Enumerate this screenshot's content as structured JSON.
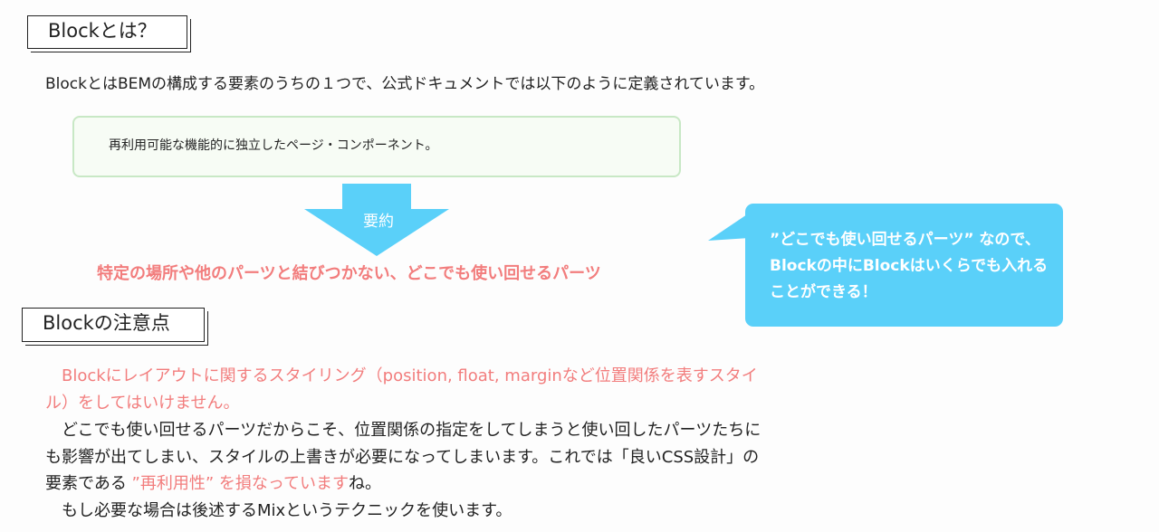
{
  "section1": {
    "heading": "Blockとは？",
    "intro": "BlockとはBEMの構成する要素のうちの１つで、公式ドキュメントでは以下のように定義されています。",
    "quote": "再利用可能な機能的に独立したページ・コンポーネント。",
    "arrow_label": "要約",
    "summary": "特定の場所や他のパーツと結びつかない、どこでも使い回せるパーツ",
    "bubble": "”どこでも使い回せるパーツ” なので、Blockの中にBlockはいくらでも入れることができる！"
  },
  "section2": {
    "heading": "Blockの注意点",
    "line1": "　Blockにレイアウトに関するスタイリング（position, float, marginなど位置関係を表すスタイ",
    "line2": "ル）をしてはいけません。",
    "line3": "　どこでも使い回せるパーツだからこそ、位置関係の指定をしてしまうと使い回したパーツたちに",
    "line4": "も影響が出てしまい、スタイルの上書きが必要になってしまいます。これでは「良いCSS設計」の",
    "line5_a": "要素である",
    "line5_b": " ”再利用性” を損なっています",
    "line5_c": "ね。",
    "line6": "　もし必要な場合は後述するMixというテクニックを使います。"
  },
  "colors": {
    "accent_pink": "#f27d7d",
    "bubble_blue": "#5ad0f9",
    "quote_border": "#c8e8c5"
  }
}
